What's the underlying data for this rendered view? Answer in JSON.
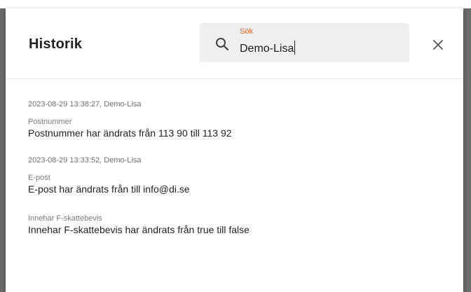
{
  "dialog": {
    "title": "Historik",
    "search": {
      "label": "Sök",
      "value": "Demo-Lisa"
    },
    "accent_color": "#e2672c",
    "close_icon": "close-icon",
    "search_icon": "search-icon"
  },
  "history": [
    {
      "meta": "2023-08-29 13:38:27, Demo-Lisa",
      "changes": [
        {
          "field": "Postnummer",
          "text": "Postnummer har ändrats från 113 90 till 113 92"
        }
      ]
    },
    {
      "meta": "2023-08-29 13:33:52, Demo-Lisa",
      "changes": [
        {
          "field": "E-post",
          "text": "E-post har ändrats från till info@di.se"
        },
        {
          "field": "Innehar F-skattebevis",
          "text": "Innehar F-skattebevis har ändrats från true till false"
        }
      ]
    }
  ]
}
